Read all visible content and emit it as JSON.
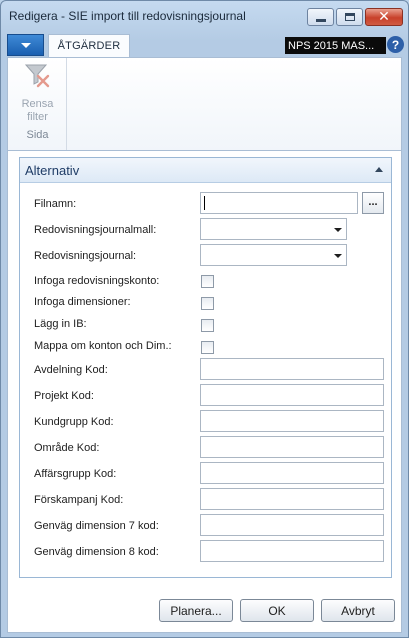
{
  "window": {
    "title": "Redigera - SIE import till redovisningsjournal"
  },
  "ribbon": {
    "tab_label": "ÅTGÄRDER",
    "company_badge": "NPS 2015 MAS...",
    "help_label": "?",
    "clear_filter_line1": "Rensa",
    "clear_filter_line2": "filter",
    "group_name": "Sida"
  },
  "fasttab": {
    "title": "Alternativ"
  },
  "fields": {
    "filename_label": "Filnamn:",
    "filename_value": "",
    "filename_lookup": "...",
    "journal_template_label": "Redovisningsjournalmall:",
    "journal_template_value": "",
    "journal_label": "Redovisningsjournal:",
    "journal_value": "",
    "insert_account_label": "Infoga redovisningskonto:",
    "insert_account_checked": false,
    "insert_dimensions_label": "Infoga dimensioner:",
    "insert_dimensions_checked": false,
    "insert_ib_label": "Lägg in IB:",
    "insert_ib_checked": false,
    "map_accounts_label": "Mappa om konton och Dim.:",
    "map_accounts_checked": false,
    "department_label": "Avdelning Kod:",
    "department_value": "",
    "project_label": "Projekt Kod:",
    "project_value": "",
    "customer_group_label": "Kundgrupp Kod:",
    "customer_group_value": "",
    "area_label": "Område Kod:",
    "area_value": "",
    "business_group_label": "Affärsgrupp Kod:",
    "business_group_value": "",
    "campaign_label": "Förskampanj Kod:",
    "campaign_value": "",
    "shortcut_dim7_label": "Genväg dimension 7 kod:",
    "shortcut_dim7_value": "",
    "shortcut_dim8_label": "Genväg dimension 8 kod:",
    "shortcut_dim8_value": ""
  },
  "footer": {
    "schedule_label": "Planera...",
    "ok_label": "OK",
    "cancel_label": "Avbryt"
  }
}
